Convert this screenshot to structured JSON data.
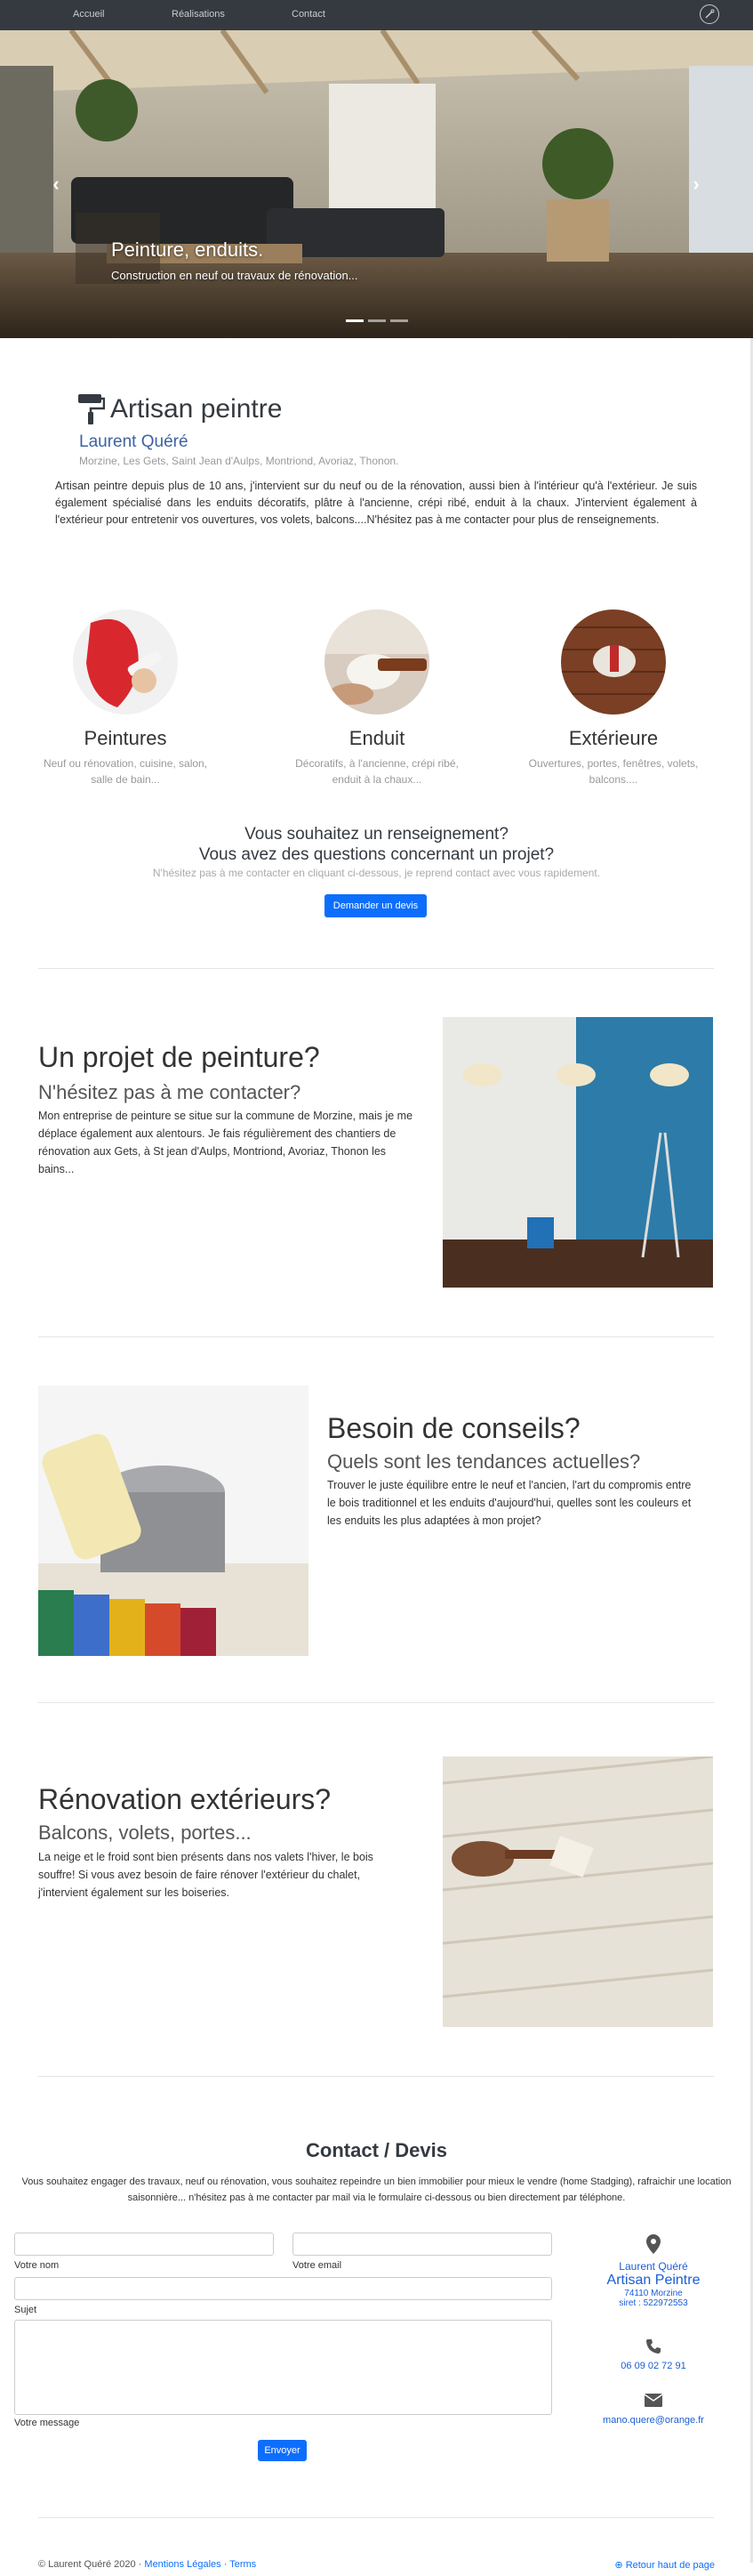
{
  "nav": {
    "items": [
      "Accueil",
      "Réalisations",
      "Contact"
    ]
  },
  "carousel": {
    "title": "Peinture, enduits.",
    "subtitle": "Construction en neuf ou travaux de rénovation...",
    "prev_icon": "chevron-left-icon",
    "next_icon": "chevron-right-icon",
    "active_slide": 1,
    "slide_count": 3
  },
  "intro": {
    "title": "Artisan peintre",
    "name": "Laurent Quéré",
    "locations": "Morzine, Les Gets, Saint Jean d'Aulps, Montriond, Avoriaz, Thonon.",
    "text": "Artisan peintre depuis plus de 10 ans, j'intervient sur du neuf ou de la rénovation, aussi bien à l'intérieur qu'à l'extérieur. Je suis également spécialisé dans les enduits décoratifs, plâtre à l'ancienne, crépi ribé, enduit à la chaux. J'intervient également à l'extérieur pour entretenir vos ouvertures, vos volets, balcons....N'hésitez pas à me contacter pour plus de renseignements."
  },
  "services": [
    {
      "title": "Peintures",
      "text": "Neuf ou rénovation, cuisine, salon, salle de bain..."
    },
    {
      "title": "Enduit",
      "text": "Décoratifs, à l'ancienne, crépi ribé, enduit à la chaux..."
    },
    {
      "title": "Extérieure",
      "text": "Ouvertures, portes, fenêtres, volets, balcons...."
    }
  ],
  "cta": {
    "line1": "Vous souhaitez un renseignement?",
    "line2": "Vous avez des questions concernant un projet?",
    "sub": "N'hésitez pas à me contacter en cliquant ci-dessous, je reprend contact avec vous rapidement.",
    "button": "Demander un devis"
  },
  "features": [
    {
      "title": "Un projet de peinture?",
      "subtitle": "N'hésitez pas à me contacter?",
      "text": "Mon entreprise de peinture se situe sur la commune de Morzine, mais je me déplace également aux alentours. Je fais régulièrement des chantiers de rénovation aux Gets, à St jean d'Aulps, Montriond, Avoriaz, Thonon les bains..."
    },
    {
      "title": "Besoin de conseils?",
      "subtitle": "Quels sont les tendances actuelles?",
      "text": "Trouver le juste équilibre entre le neuf et l'ancien, l'art du compromis entre le bois traditionnel et les enduits d'aujourd'hui, quelles sont les couleurs et les enduits les plus adaptées à mon projet?"
    },
    {
      "title": "Rénovation extérieurs?",
      "subtitle": "Balcons, volets, portes...",
      "text": "La neige et le froid sont bien présents dans nos valets l'hiver, le bois souffre! Si vous avez besoin de faire rénover l'extérieur du chalet, j'intervient également sur les boiseries."
    }
  ],
  "contact": {
    "title": "Contact / Devis",
    "text": "Vous souhaitez engager des travaux, neuf ou rénovation, vous souhaitez repeindre un bien immobilier pour mieux le vendre (home Stadging), rafraichir une location saisonnière... n'hésitez pas à me contacter par mail via le formulaire ci-dessous ou bien directement par téléphone.",
    "labels": {
      "name": "Votre nom",
      "email": "Votre email",
      "subject": "Sujet",
      "message": "Votre message"
    },
    "submit": "Envoyer",
    "info": {
      "name": "Laurent Quéré",
      "company": "Artisan Peintre",
      "city": "74110 Morzine",
      "siret": "siret : 522972553",
      "phone": "06 09 02 72 91",
      "email": "mano.quere@orange.fr"
    }
  },
  "footer": {
    "copyright": "© Laurent Quéré 2020 ·",
    "legal": "Mentions Légales",
    "sep": "·",
    "terms": "Terms",
    "back_top": "Retour haut de page"
  },
  "colors": {
    "accent": "#0d6efd",
    "navbar": "#343a40",
    "link": "#1a5dd5"
  }
}
